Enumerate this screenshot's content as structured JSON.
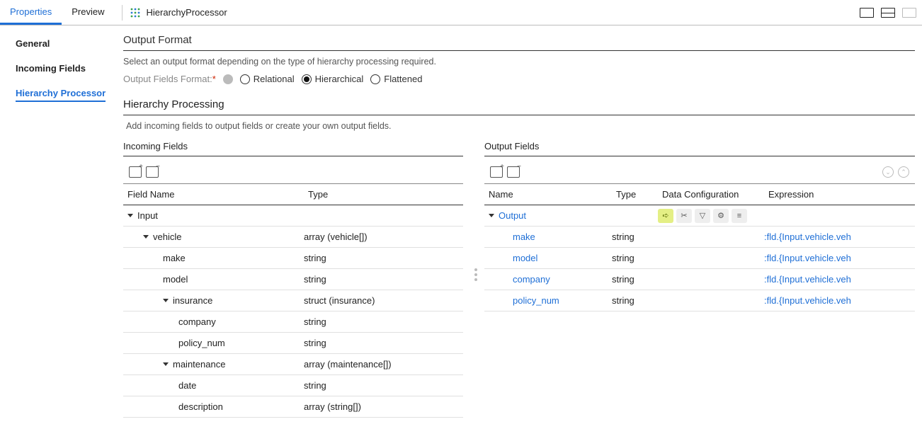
{
  "topTabs": {
    "properties": "Properties",
    "preview": "Preview"
  },
  "processorName": "HierarchyProcessor",
  "sideNav": {
    "general": "General",
    "incoming": "Incoming Fields",
    "hier": "Hierarchy Processor"
  },
  "outputFormat": {
    "title": "Output Format",
    "desc": "Select an output format depending on the type of hierarchy processing required.",
    "label": "Output Fields Format:",
    "options": {
      "relational": "Relational",
      "hierarchical": "Hierarchical",
      "flattened": "Flattened"
    }
  },
  "hierProcessing": {
    "title": "Hierarchy Processing",
    "desc": "Add incoming fields to output fields or create your own output fields."
  },
  "incomingFields": {
    "title": "Incoming Fields",
    "headers": {
      "name": "Field Name",
      "type": "Type"
    },
    "rows": [
      {
        "depth": 0,
        "caret": true,
        "name": "Input",
        "type": ""
      },
      {
        "depth": 1,
        "caret": true,
        "name": "vehicle",
        "type": "array (vehicle[])"
      },
      {
        "depth": 2,
        "caret": false,
        "name": "make",
        "type": "string"
      },
      {
        "depth": 2,
        "caret": false,
        "name": "model",
        "type": "string"
      },
      {
        "depth": 2,
        "caret": true,
        "name": "insurance",
        "type": "struct (insurance)"
      },
      {
        "depth": 3,
        "caret": false,
        "name": "company",
        "type": "string"
      },
      {
        "depth": 3,
        "caret": false,
        "name": "policy_num",
        "type": "string"
      },
      {
        "depth": 2,
        "caret": true,
        "name": "maintenance",
        "type": "array (maintenance[])"
      },
      {
        "depth": 3,
        "caret": false,
        "name": "date",
        "type": "string"
      },
      {
        "depth": 3,
        "caret": false,
        "name": "description",
        "type": "array (string[])"
      }
    ]
  },
  "outputFields": {
    "title": "Output Fields",
    "headers": {
      "name": "Name",
      "type": "Type",
      "cfg": "Data Configuration",
      "expr": "Expression"
    },
    "rows": [
      {
        "depth": 0,
        "caret": true,
        "name": "Output",
        "type": "",
        "cfg": true,
        "expr": ""
      },
      {
        "depth": 1,
        "caret": false,
        "name": "make",
        "type": "string",
        "cfg": false,
        "expr": ":fld.{Input.vehicle.veh"
      },
      {
        "depth": 1,
        "caret": false,
        "name": "model",
        "type": "string",
        "cfg": false,
        "expr": ":fld.{Input.vehicle.veh"
      },
      {
        "depth": 1,
        "caret": false,
        "name": "company",
        "type": "string",
        "cfg": false,
        "expr": ":fld.{Input.vehicle.veh"
      },
      {
        "depth": 1,
        "caret": false,
        "name": "policy_num",
        "type": "string",
        "cfg": false,
        "expr": ":fld.{Input.vehicle.veh"
      }
    ]
  }
}
